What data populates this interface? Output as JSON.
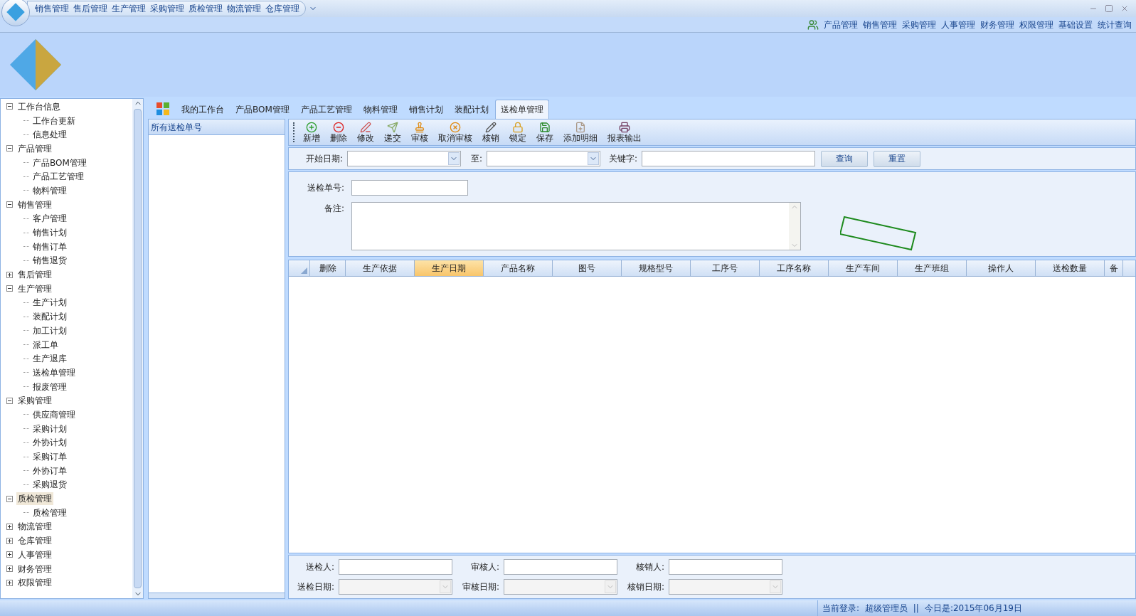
{
  "quick_menu": [
    "销售管理",
    "售后管理",
    "生产管理",
    "采购管理",
    "质检管理",
    "物流管理",
    "仓库管理"
  ],
  "top_menu": [
    "产品管理",
    "销售管理",
    "采购管理",
    "人事管理",
    "财务管理",
    "权限管理",
    "基础设置",
    "统计查询"
  ],
  "tree": [
    {
      "label": "工作台信息",
      "expanded": true,
      "selected": false,
      "children": [
        {
          "label": "工作台更新",
          "selected": false
        },
        {
          "label": "信息处理",
          "selected": false
        }
      ]
    },
    {
      "label": "产品管理",
      "expanded": true,
      "selected": false,
      "children": [
        {
          "label": "产品BOM管理",
          "selected": false
        },
        {
          "label": "产品工艺管理",
          "selected": false
        },
        {
          "label": "物料管理",
          "selected": false
        }
      ]
    },
    {
      "label": "销售管理",
      "expanded": true,
      "selected": false,
      "children": [
        {
          "label": "客户管理",
          "selected": false
        },
        {
          "label": "销售计划",
          "selected": false
        },
        {
          "label": "销售订单",
          "selected": false
        },
        {
          "label": "销售退货",
          "selected": false
        }
      ]
    },
    {
      "label": "售后管理",
      "expanded": false,
      "selected": false
    },
    {
      "label": "生产管理",
      "expanded": true,
      "selected": false,
      "children": [
        {
          "label": "生产计划",
          "selected": false
        },
        {
          "label": "装配计划",
          "selected": false
        },
        {
          "label": "加工计划",
          "selected": false
        },
        {
          "label": "派工单",
          "selected": false
        },
        {
          "label": "生产退库",
          "selected": false
        },
        {
          "label": "送检单管理",
          "selected": false
        },
        {
          "label": "报废管理",
          "selected": false
        }
      ]
    },
    {
      "label": "采购管理",
      "expanded": true,
      "selected": false,
      "children": [
        {
          "label": "供应商管理",
          "selected": false
        },
        {
          "label": "采购计划",
          "selected": false
        },
        {
          "label": "外协计划",
          "selected": false
        },
        {
          "label": "采购订单",
          "selected": false
        },
        {
          "label": "外协订单",
          "selected": false
        },
        {
          "label": "采购退货",
          "selected": false
        }
      ]
    },
    {
      "label": "质检管理",
      "expanded": true,
      "selected": true,
      "children": [
        {
          "label": "质检管理",
          "selected": false
        }
      ]
    },
    {
      "label": "物流管理",
      "expanded": false,
      "selected": false
    },
    {
      "label": "仓库管理",
      "expanded": false,
      "selected": false
    },
    {
      "label": "人事管理",
      "expanded": false,
      "selected": false
    },
    {
      "label": "财务管理",
      "expanded": false,
      "selected": false
    },
    {
      "label": "权限管理",
      "expanded": false,
      "selected": false
    }
  ],
  "tabs": [
    {
      "label": "我的工作台",
      "selected": false
    },
    {
      "label": "产品BOM管理",
      "selected": false
    },
    {
      "label": "产品工艺管理",
      "selected": false
    },
    {
      "label": "物料管理",
      "selected": false
    },
    {
      "label": "销售计划",
      "selected": false
    },
    {
      "label": "装配计划",
      "selected": false
    },
    {
      "label": "送检单管理",
      "selected": true
    }
  ],
  "list_panel": {
    "title": "所有送检单号"
  },
  "toolbar": [
    "新增",
    "删除",
    "修改",
    "递交",
    "审核",
    "取消审核",
    "核销",
    "锁定",
    "保存",
    "添加明细",
    "报表输出"
  ],
  "filter": {
    "start_label": "开始日期:",
    "to_label": "至:",
    "keyword_label": "关键字:",
    "buttons": [
      "查询",
      "重置"
    ]
  },
  "form": {
    "number_label": "送检单号:",
    "remark_label": "备注:"
  },
  "grid": {
    "columns": [
      {
        "label": "删除",
        "selected": false
      },
      {
        "label": "生产依据",
        "selected": false
      },
      {
        "label": "生产日期",
        "selected": true
      },
      {
        "label": "产品名称",
        "selected": false
      },
      {
        "label": "图号",
        "selected": false
      },
      {
        "label": "规格型号",
        "selected": false
      },
      {
        "label": "工序号",
        "selected": false
      },
      {
        "label": "工序名称",
        "selected": false
      },
      {
        "label": "生产车间",
        "selected": false
      },
      {
        "label": "生产班组",
        "selected": false
      },
      {
        "label": "操作人",
        "selected": false
      },
      {
        "label": "送检数量",
        "selected": false
      },
      {
        "label": "备",
        "selected": false
      }
    ]
  },
  "footer_fields": [
    {
      "label": "送检人:",
      "kind": "text"
    },
    {
      "label": "审核人:",
      "kind": "text"
    },
    {
      "label": "核销人:",
      "kind": "text"
    },
    {
      "label": "送检日期:",
      "kind": "date"
    },
    {
      "label": "审核日期:",
      "kind": "date"
    },
    {
      "label": "核销日期:",
      "kind": "date"
    }
  ],
  "status_bar": {
    "login": "当前登录:  超级管理员",
    "separator": "||",
    "date": "今日是:2015年06月19日"
  }
}
